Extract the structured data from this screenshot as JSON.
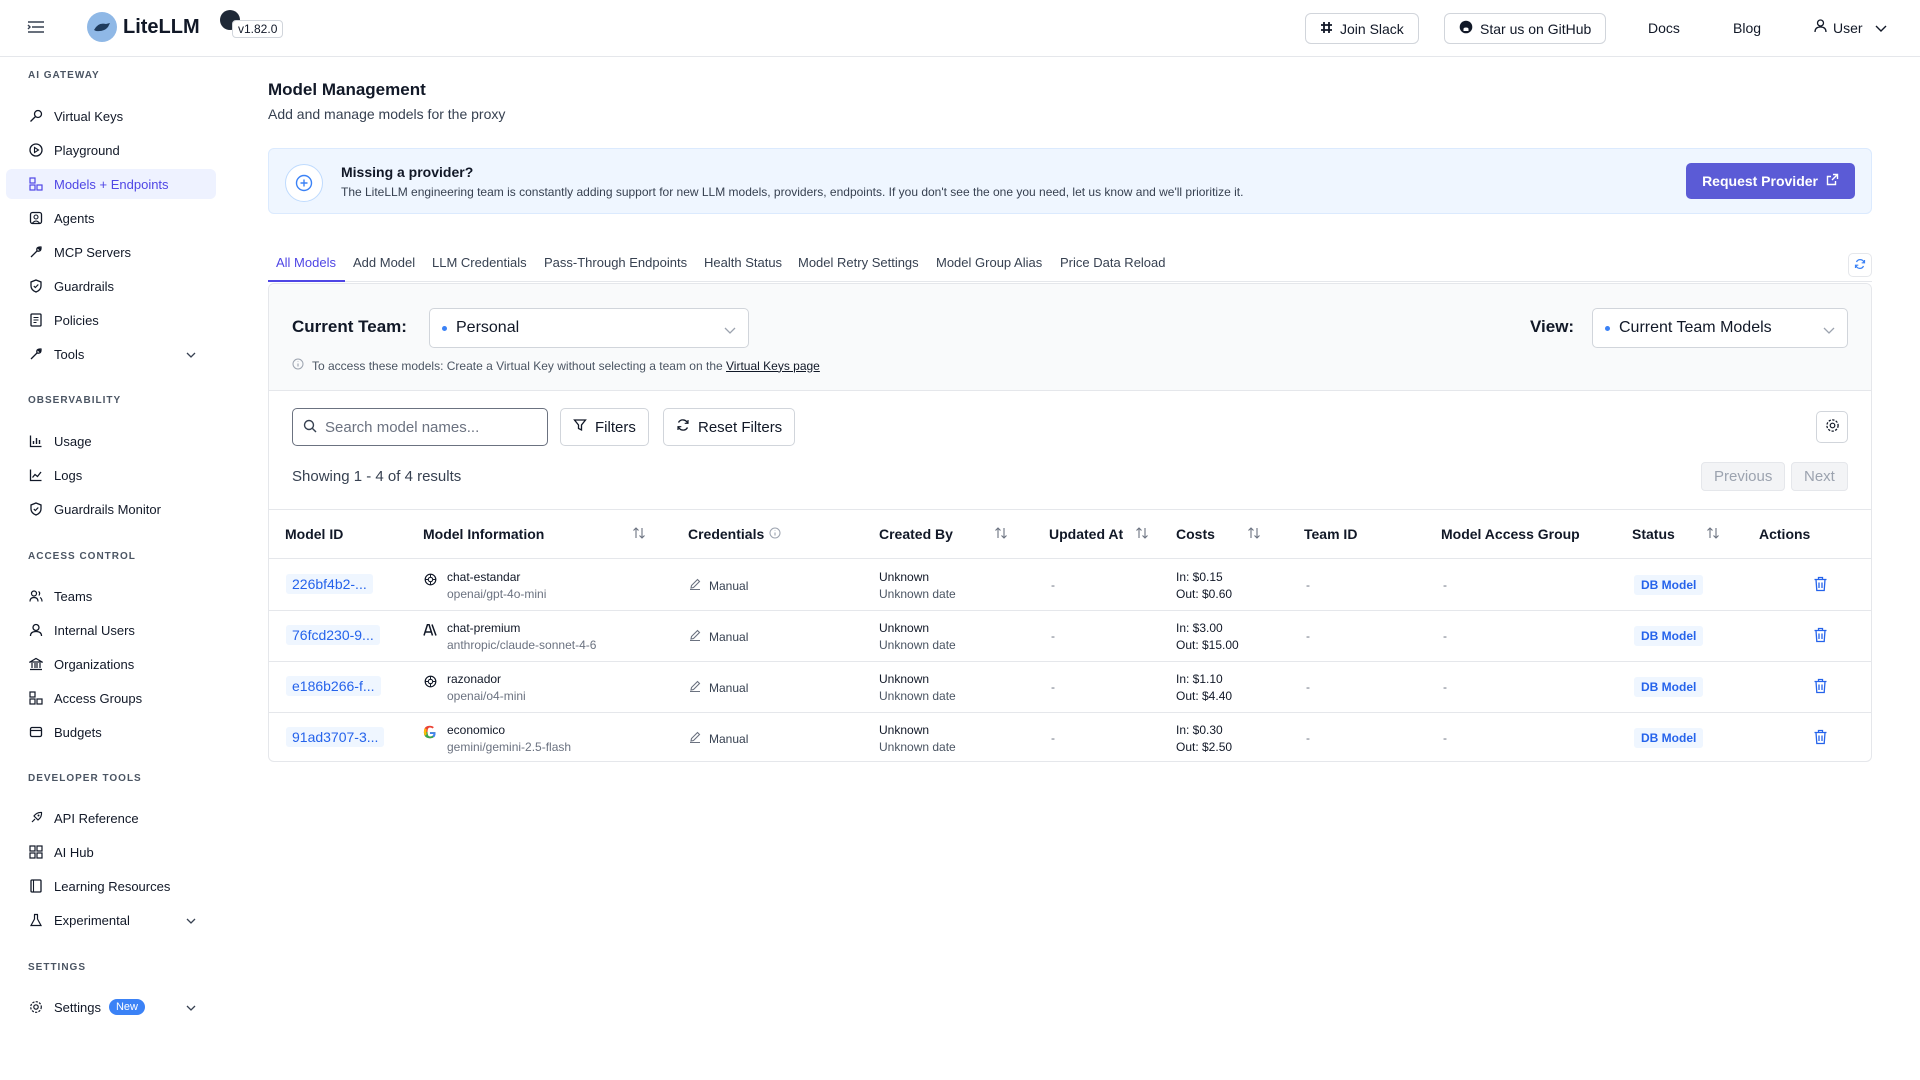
{
  "header": {
    "brand": "LiteLLM",
    "version": "v1.82.0",
    "join_slack": "Join Slack",
    "star_github": "Star us on GitHub",
    "docs": "Docs",
    "blog": "Blog",
    "user": "User"
  },
  "sidebar": {
    "sections": {
      "ai_gateway": "AI GATEWAY",
      "observability": "OBSERVABILITY",
      "access_control": "ACCESS CONTROL",
      "developer_tools": "DEVELOPER TOOLS",
      "settings": "SETTINGS"
    },
    "items": {
      "virtual_keys": "Virtual Keys",
      "playground": "Playground",
      "models": "Models + Endpoints",
      "agents": "Agents",
      "mcp": "MCP Servers",
      "guardrails": "Guardrails",
      "policies": "Policies",
      "tools": "Tools",
      "usage": "Usage",
      "logs": "Logs",
      "guardrails_monitor": "Guardrails Monitor",
      "teams": "Teams",
      "internal_users": "Internal Users",
      "organizations": "Organizations",
      "access_groups": "Access Groups",
      "budgets": "Budgets",
      "api_reference": "API Reference",
      "ai_hub": "AI Hub",
      "learning": "Learning Resources",
      "experimental": "Experimental",
      "settings": "Settings",
      "settings_badge": "New"
    },
    "active": "models"
  },
  "page": {
    "title": "Model Management",
    "subtitle": "Add and manage models for the proxy"
  },
  "banner": {
    "title": "Missing a provider?",
    "text": "The LiteLLM engineering team is constantly adding support for new LLM models, providers, endpoints. If you don't see the one you need, let us know and we'll prioritize it.",
    "button": "Request Provider"
  },
  "tabs": [
    "All Models",
    "Add Model",
    "LLM Credentials",
    "Pass-Through Endpoints",
    "Health Status",
    "Model Retry Settings",
    "Model Group Alias",
    "Price Data Reload"
  ],
  "filters": {
    "current_team_label": "Current Team:",
    "current_team_value": "Personal",
    "view_label": "View:",
    "view_value": "Current Team Models",
    "info_text": "To access these models: Create a Virtual Key without selecting a team on the",
    "info_link": "Virtual Keys page",
    "search_placeholder": "Search model names...",
    "filters_btn": "Filters",
    "reset_btn": "Reset Filters",
    "showing": "Showing 1 - 4 of 4 results",
    "previous": "Previous",
    "next": "Next"
  },
  "table": {
    "headers": {
      "model_id": "Model ID",
      "model_info": "Model Information",
      "credentials": "Credentials",
      "created_by": "Created By",
      "updated_at": "Updated At",
      "costs": "Costs",
      "team_id": "Team ID",
      "access_group": "Model Access Group",
      "status": "Status",
      "actions": "Actions"
    },
    "rows": [
      {
        "id": "226bf4b2-...",
        "provider_icon": "openai-icon",
        "name": "chat-estandar",
        "model": "openai/gpt-4o-mini",
        "cred": "Manual",
        "created_by": "Unknown",
        "created_date": "Unknown date",
        "updated": "-",
        "cost_in": "In: $0.15",
        "cost_out": "Out: $0.60",
        "team": "-",
        "group": "-",
        "status": "DB Model"
      },
      {
        "id": "76fcd230-9...",
        "provider_icon": "anthropic-icon",
        "name": "chat-premium",
        "model": "anthropic/claude-sonnet-4-6",
        "cred": "Manual",
        "created_by": "Unknown",
        "created_date": "Unknown date",
        "updated": "-",
        "cost_in": "In: $3.00",
        "cost_out": "Out: $15.00",
        "team": "-",
        "group": "-",
        "status": "DB Model"
      },
      {
        "id": "e186b266-f...",
        "provider_icon": "openai-icon",
        "name": "razonador",
        "model": "openai/o4-mini",
        "cred": "Manual",
        "created_by": "Unknown",
        "created_date": "Unknown date",
        "updated": "-",
        "cost_in": "In: $1.10",
        "cost_out": "Out: $4.40",
        "team": "-",
        "group": "-",
        "status": "DB Model"
      },
      {
        "id": "91ad3707-3...",
        "provider_icon": "google-icon",
        "name": "economico",
        "model": "gemini/gemini-2.5-flash",
        "cred": "Manual",
        "created_by": "Unknown",
        "created_date": "Unknown date",
        "updated": "-",
        "cost_in": "In: $0.30",
        "cost_out": "Out: $2.50",
        "team": "-",
        "group": "-",
        "status": "DB Model"
      }
    ]
  },
  "colors": {
    "accent": "#4f46e5",
    "request_button": "#5b5bd6",
    "id_chip_bg": "#eff6ff",
    "id_chip_text": "#2563eb",
    "delete_icon": "#2563eb"
  }
}
